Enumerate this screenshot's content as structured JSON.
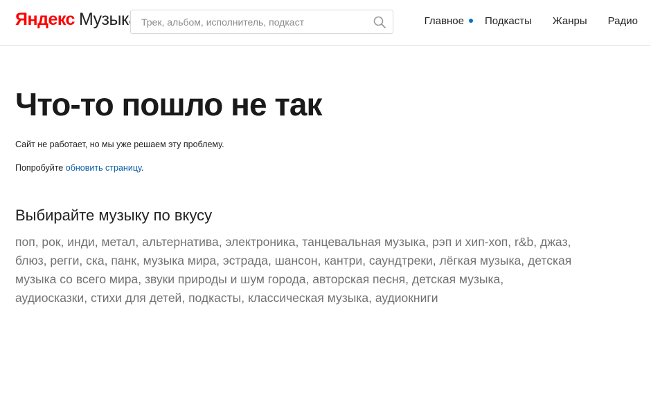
{
  "header": {
    "logo": {
      "brand": "Яндекс",
      "service": "Музыка"
    },
    "search": {
      "placeholder": "Трек, альбом, исполнитель, подкаст",
      "value": "",
      "icon": "search-icon"
    },
    "nav": [
      {
        "label": "Главное",
        "active": true
      },
      {
        "label": "Подкасты",
        "active": false
      },
      {
        "label": "Жанры",
        "active": false
      },
      {
        "label": "Радио",
        "active": false
      }
    ]
  },
  "error": {
    "title": "Что-то пошло не так",
    "message": "Сайт не работает, но мы уже решаем эту проблему.",
    "retry_prefix": "Попробуйте ",
    "retry_link": "обновить страницу",
    "retry_suffix": "."
  },
  "genres": {
    "title": "Выбирайте музыку по вкусу",
    "items": [
      "поп",
      "рок",
      "инди",
      "метал",
      "альтернатива",
      "электроника",
      "танцевальная музыка",
      "рэп и хип-хоп",
      "r&b",
      "джаз",
      "блюз",
      "регги",
      "ска",
      "панк",
      "музыка мира",
      "эстрада",
      "шансон",
      "кантри",
      "саундтреки",
      "лёгкая музыка",
      "детская музыка со всего мира",
      "звуки природы и шум города",
      "авторская песня",
      "детская музыка",
      "аудиосказки",
      "стихи для детей",
      "подкасты",
      "классическая музыка",
      "аудиокниги"
    ]
  },
  "colors": {
    "brand": "#ff0000",
    "link": "#0a5fa8",
    "active_dot": "#0a71c4",
    "genre_text": "#727272"
  }
}
